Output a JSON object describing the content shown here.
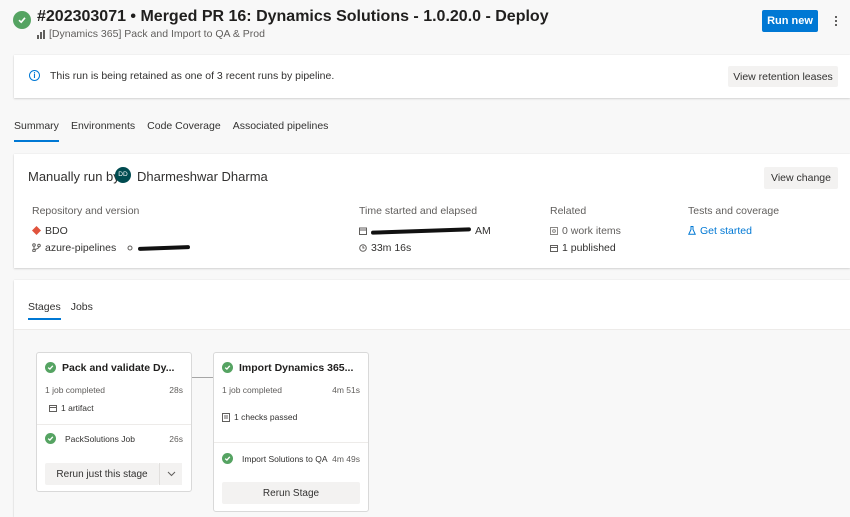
{
  "header": {
    "run_title": "#202303071 • Merged PR 16: Dynamics Solutions - 1.0.20.0 - Deploy",
    "pipeline_name": "[Dynamics 365] Pack and Import to QA & Prod",
    "run_new_label": "Run new"
  },
  "banner": {
    "text": "This run is being retained as one of 3 recent runs by pipeline.",
    "button_label": "View retention leases"
  },
  "tabs": [
    {
      "label": "Summary"
    },
    {
      "label": "Environments"
    },
    {
      "label": "Code Coverage"
    },
    {
      "label": "Associated pipelines"
    }
  ],
  "summary": {
    "manual_run_label": "Manually run by",
    "avatar_initials": "DD",
    "user_name": "Dharmeshwar Dharma",
    "view_change_label": "View change",
    "repository": {
      "label": "Repository and version",
      "repo": "BDO",
      "branch": "azure-pipelines"
    },
    "time": {
      "label": "Time started and elapsed",
      "started_suffix": "AM",
      "elapsed": "33m 16s"
    },
    "related": {
      "label": "Related",
      "work_items": "0 work items",
      "published": "1 published"
    },
    "tests": {
      "label": "Tests and coverage",
      "link": "Get started"
    }
  },
  "stages_tabs": [
    {
      "label": "Stages"
    },
    {
      "label": "Jobs"
    }
  ],
  "stages": [
    {
      "name": "Pack and validate Dy...",
      "jobs_completed": "1 job completed",
      "duration": "28s",
      "extra": "1 artifact",
      "job_name": "PackSolutions Job",
      "job_duration": "26s",
      "button_label": "Rerun just this stage"
    },
    {
      "name": "Import Dynamics 365...",
      "jobs_completed": "1 job completed",
      "duration": "4m 51s",
      "extra": "1 checks passed",
      "job_name": "Import Solutions to QA",
      "job_duration": "4m 49s",
      "button_label": "Rerun Stage"
    }
  ],
  "colors": {
    "accent": "#0078d4",
    "success": "#55a362"
  }
}
